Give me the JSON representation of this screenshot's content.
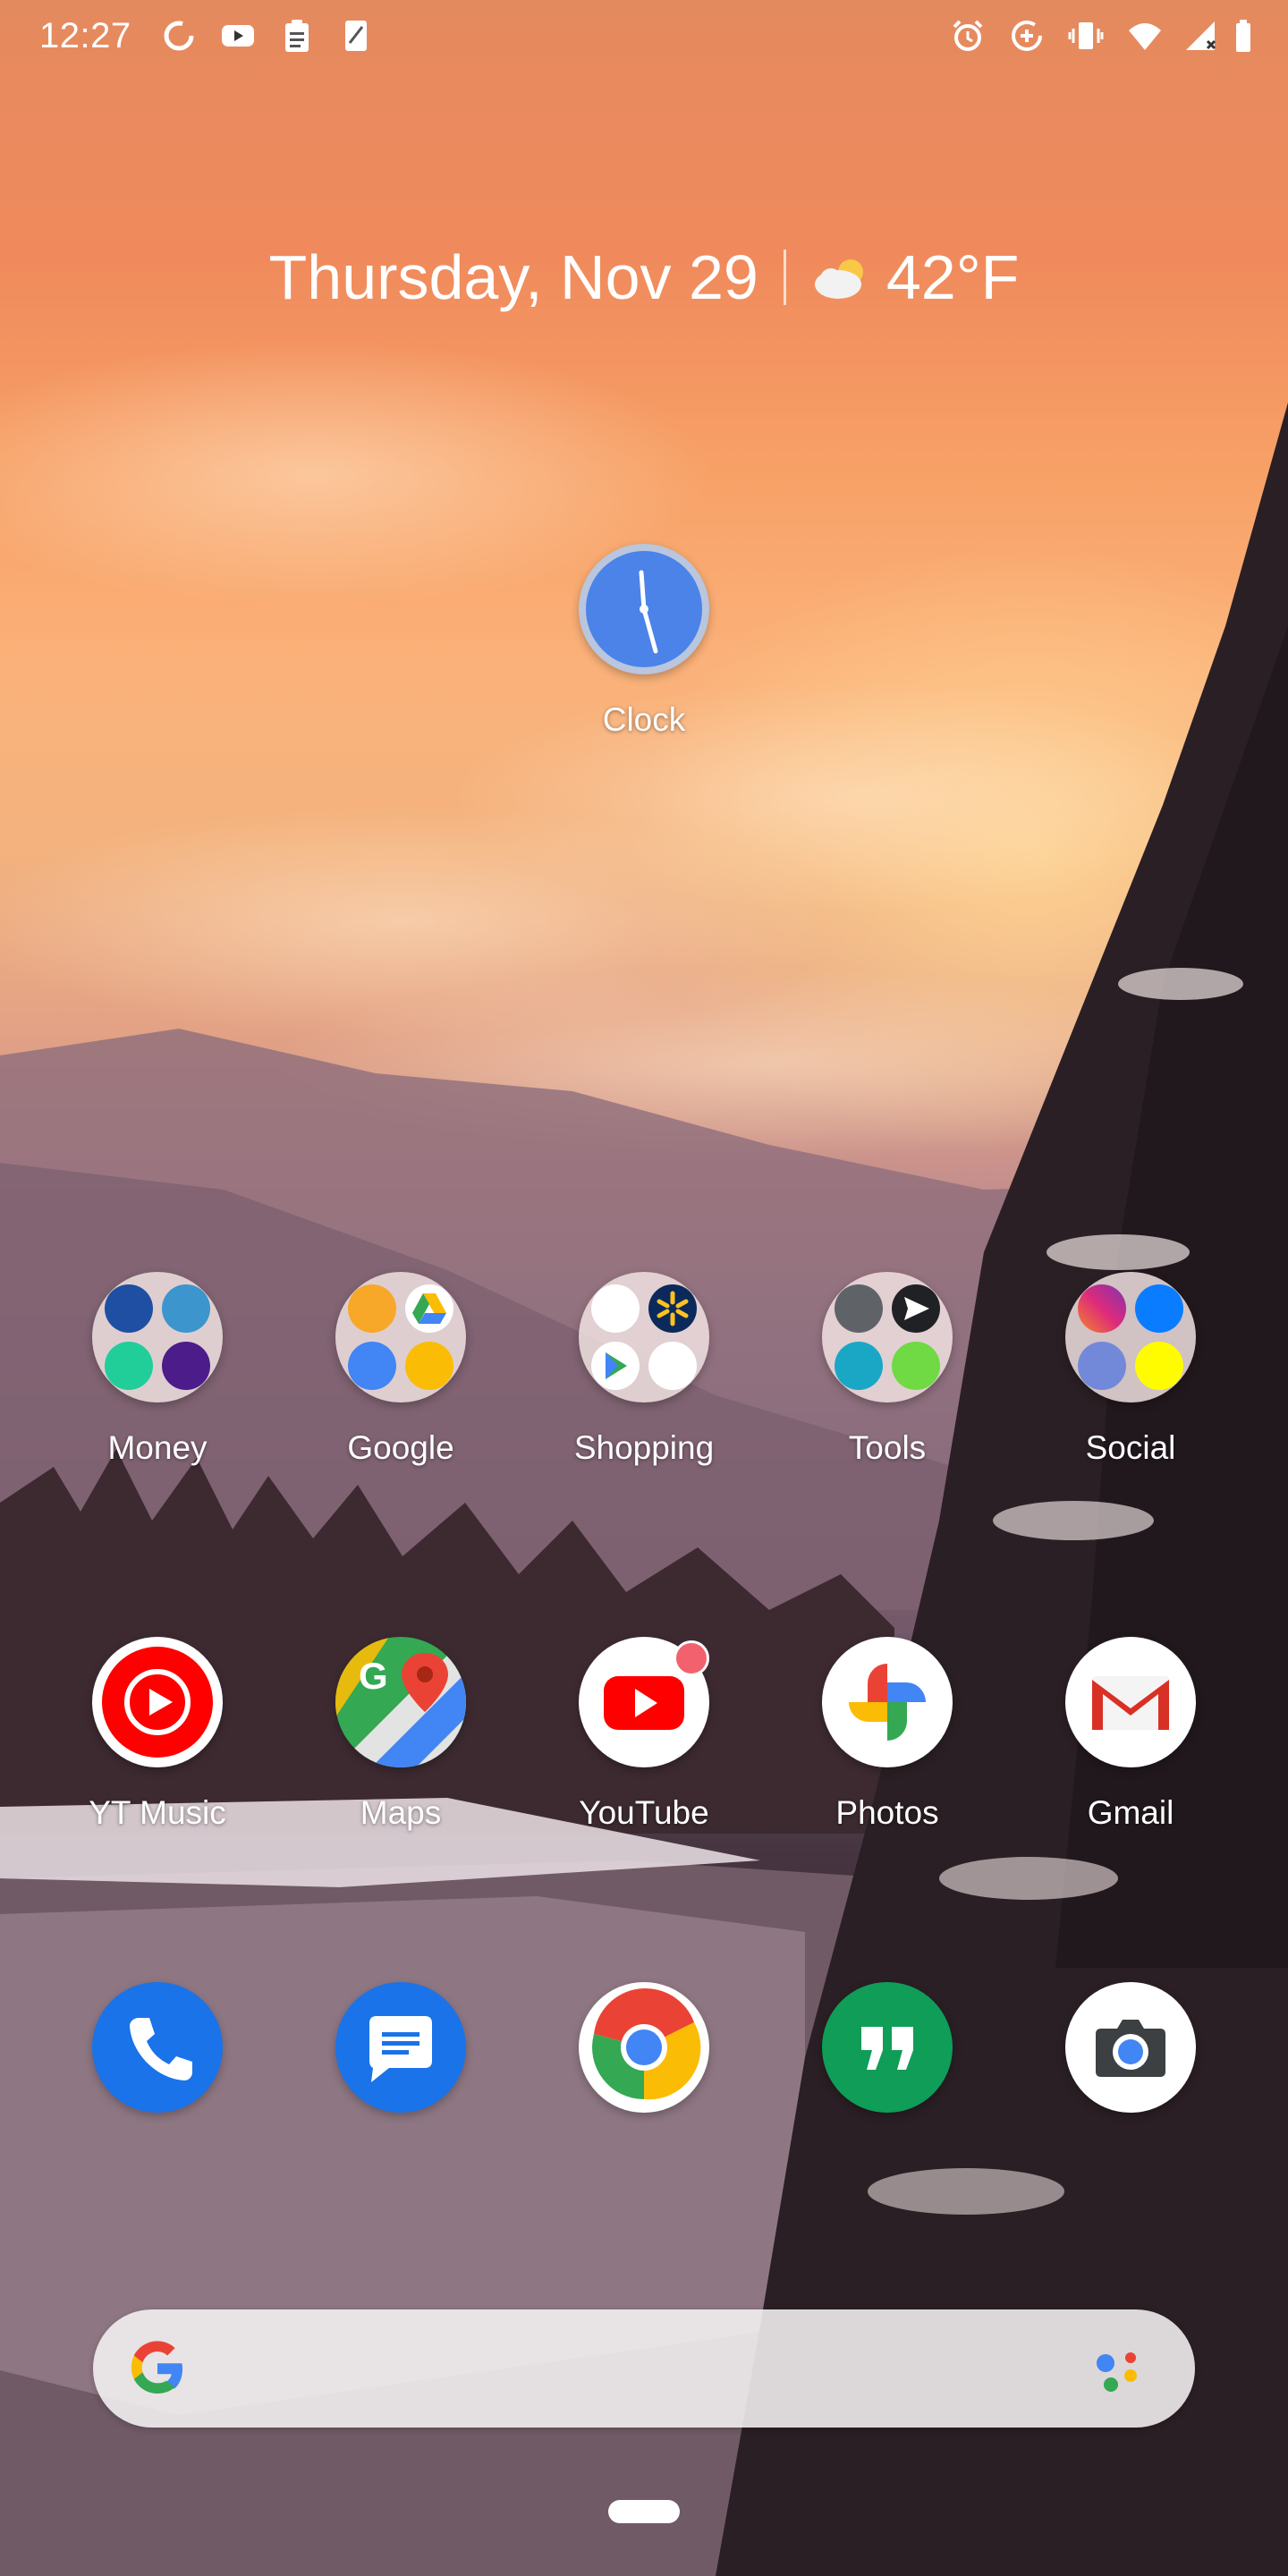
{
  "status_bar": {
    "time": "12:27",
    "left_icons": [
      "sync-icon",
      "youtube-icon",
      "clipboard-icon",
      "tablet-icon"
    ],
    "right_icons": [
      "alarm-icon",
      "data-saver-icon",
      "vibrate-icon",
      "wifi-icon",
      "signal-icon",
      "battery-icon"
    ]
  },
  "glance": {
    "date": "Thursday, Nov 29",
    "temperature": "42°F",
    "weather_icon": "partly-cloudy-icon"
  },
  "clock_widget": {
    "label": "Clock"
  },
  "folders": [
    {
      "label": "Money"
    },
    {
      "label": "Google"
    },
    {
      "label": "Shopping"
    },
    {
      "label": "Tools"
    },
    {
      "label": "Social"
    }
  ],
  "apps": [
    {
      "label": "YT Music"
    },
    {
      "label": "Maps"
    },
    {
      "label": "YouTube"
    },
    {
      "label": "Photos"
    },
    {
      "label": "Gmail"
    }
  ],
  "dock": [
    "phone-icon",
    "messages-icon",
    "chrome-icon",
    "hangouts-icon",
    "camera-icon"
  ],
  "search": {
    "logo": "google-g-icon",
    "assistant": "assistant-icon"
  },
  "colors": {
    "google_blue": "#4285F4",
    "google_red": "#EA4335",
    "google_yellow": "#FBBC05",
    "google_green": "#34A853"
  }
}
